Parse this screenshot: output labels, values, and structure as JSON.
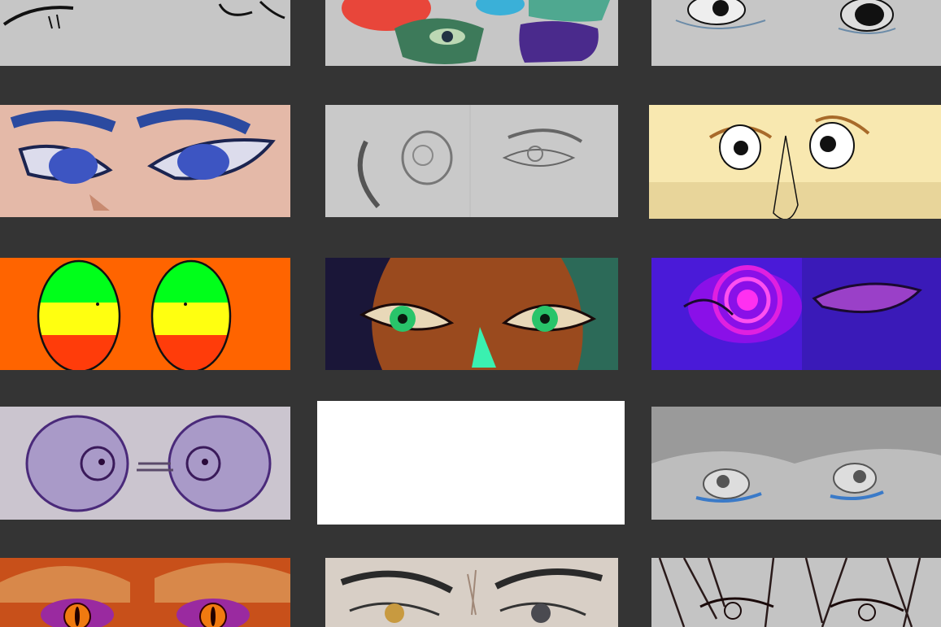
{
  "gallery": {
    "background": "#343434",
    "tiles": [
      {
        "id": "r1c1",
        "subject": "sketch-eyes-grey",
        "bg": "#c6c6c6"
      },
      {
        "id": "r1c2",
        "subject": "multicolor-eyes-collage",
        "bg": "#c6c6c6"
      },
      {
        "id": "r1c3",
        "subject": "sketch-eyes-teary",
        "bg": "#c6c6c6"
      },
      {
        "id": "r2c1",
        "subject": "blue-anime-eyes",
        "bg": "#e4b9a8"
      },
      {
        "id": "r2c2",
        "subject": "pencil-eyes-sketch",
        "bg": "#c9c9c9"
      },
      {
        "id": "r2c3",
        "subject": "cartoon-eyes-nose",
        "bg": "#f8e8b0"
      },
      {
        "id": "r3c1",
        "subject": "tricolor-oval-eyes",
        "bg": "#ff6400"
      },
      {
        "id": "r3c2",
        "subject": "green-eyes-painting",
        "bg": "#2a2240"
      },
      {
        "id": "r3c3",
        "subject": "purple-hypno-eyes",
        "bg": "#4a1ad8"
      },
      {
        "id": "r4c1",
        "subject": "purple-round-eyes",
        "bg": "#cbc5cf"
      },
      {
        "id": "r4c2",
        "subject": "blank-tile",
        "bg": "#ffffff"
      },
      {
        "id": "r4c3",
        "subject": "grey-hair-eyes",
        "bg": "#bdbdbd"
      },
      {
        "id": "r5c1",
        "subject": "orange-dragon-eyes",
        "bg": "#c8501a"
      },
      {
        "id": "r5c2",
        "subject": "realistic-brows",
        "bg": "#d8cfc6"
      },
      {
        "id": "r5c3",
        "subject": "lineart-hair-eyes",
        "bg": "#c4c4c4"
      }
    ]
  }
}
